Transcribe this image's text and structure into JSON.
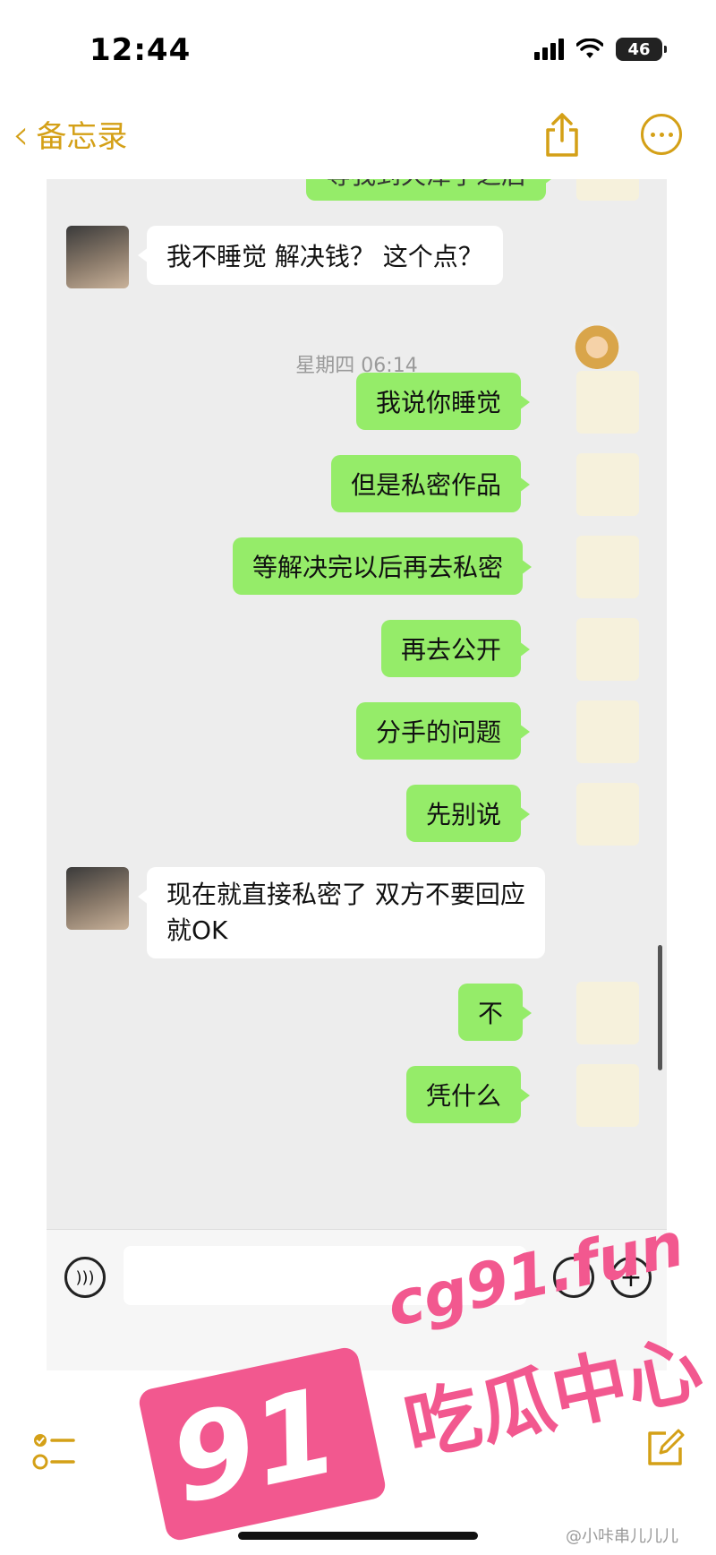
{
  "status_bar": {
    "time": "12:44",
    "battery": "46"
  },
  "nav": {
    "back_label": "备忘录"
  },
  "chat": {
    "top_partial": "等我到天津了之后",
    "timestamp": "星期四 06:14",
    "messages": [
      {
        "sender": "them",
        "text": "我不睡觉 解决钱？ 这个点？"
      },
      {
        "sender": "me",
        "text": "我说你睡觉"
      },
      {
        "sender": "me",
        "text": "但是私密作品"
      },
      {
        "sender": "me",
        "text": "等解决完以后再去私密"
      },
      {
        "sender": "me",
        "text": "再去公开"
      },
      {
        "sender": "me",
        "text": "分手的问题"
      },
      {
        "sender": "me",
        "text": "先别说"
      },
      {
        "sender": "them",
        "text_line1": "现在就直接私密了 双方不要回应",
        "text_line2": "就OK"
      },
      {
        "sender": "me",
        "text": "不"
      },
      {
        "sender": "me",
        "text": "凭什么"
      }
    ],
    "input_placeholder": ""
  },
  "watermark": {
    "logo": "91",
    "site": "cg91.fun",
    "tagline": "吃瓜中心",
    "credit": "@小咔串儿儿儿"
  },
  "icons": {
    "back": "chevron-left-icon",
    "share": "share-icon",
    "more": "more-icon",
    "voice": "voice-icon",
    "emoji": "emoji-icon",
    "add": "plus-icon",
    "checklist": "checklist-icon",
    "compose": "compose-icon"
  },
  "colors": {
    "accent": "#d4a017",
    "bubble_me": "#95ec69",
    "bubble_them": "#ffffff",
    "chat_bg": "#ededed",
    "watermark": "#f2588f"
  }
}
